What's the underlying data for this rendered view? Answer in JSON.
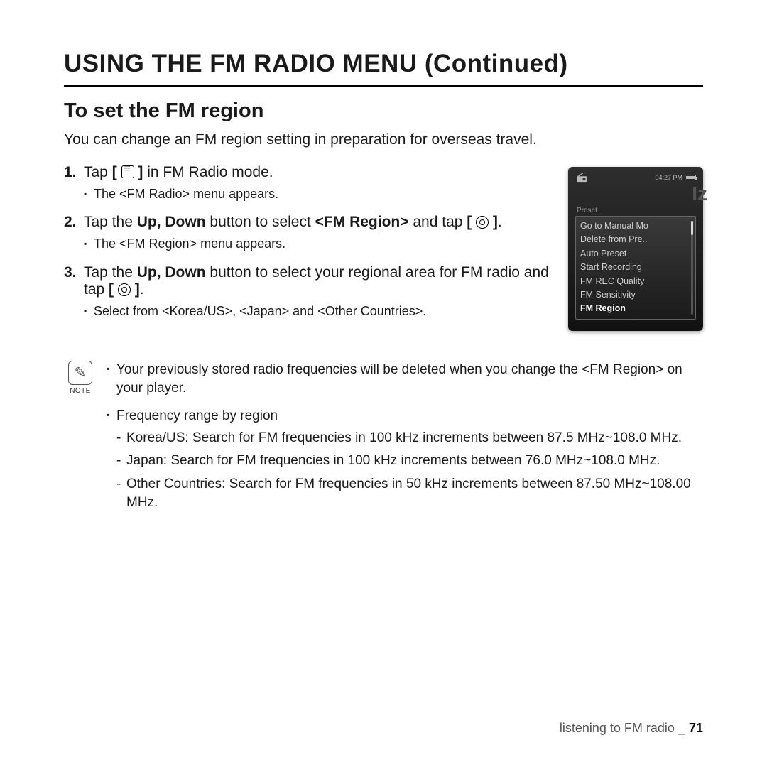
{
  "page": {
    "title": "USING THE FM RADIO MENU (Continued)",
    "section": "To set the FM region",
    "intro": "You can change an FM region setting in preparation for overseas travel."
  },
  "steps": [
    {
      "num": "1.",
      "pre": "Tap ",
      "icon": "menu-icon",
      "post": " in FM Radio mode.",
      "sub": [
        "The <FM Radio> menu appears."
      ]
    },
    {
      "num": "2.",
      "pre": "Tap the ",
      "bold1": "Up, Down",
      "mid1": " button to select ",
      "bold2": "<FM Region>",
      "mid2": " and tap ",
      "icon": "select-icon",
      "post": ".",
      "sub": [
        "The <FM Region> menu appears."
      ]
    },
    {
      "num": "3.",
      "pre": "Tap the ",
      "bold1": "Up, Down",
      "mid1": " button to select your regional area for FM radio and tap ",
      "icon": "select-icon",
      "post": ".",
      "sub": [
        "Select from <Korea/US>, <Japan> and <Other Countries>."
      ]
    }
  ],
  "device": {
    "time": "04:27 PM",
    "preset_label": "Preset",
    "hz_bg": "Iz",
    "menu": [
      {
        "label": "Go to Manual Mo",
        "sel": false
      },
      {
        "label": "Delete from Pre..",
        "sel": false
      },
      {
        "label": "Auto Preset",
        "sel": false
      },
      {
        "label": "Start Recording",
        "sel": false
      },
      {
        "label": "FM REC Quality",
        "sel": false
      },
      {
        "label": "FM Sensitivity",
        "sel": false
      },
      {
        "label": "FM Region",
        "sel": true
      }
    ]
  },
  "note": {
    "label": "NOTE",
    "items": [
      "Your previously stored radio frequencies will be deleted when you change the <FM Region> on your player.",
      "Frequency range by region"
    ],
    "ranges": [
      "Korea/US: Search for FM frequencies in 100 kHz increments between 87.5 MHz~108.0 MHz.",
      "Japan: Search for FM frequencies in 100 kHz increments between 76.0 MHz~108.0 MHz.",
      "Other Countries: Search for FM frequencies in 50 kHz increments between 87.50 MHz~108.00 MHz."
    ]
  },
  "footer": {
    "section": "listening to FM radio _",
    "page": "71"
  }
}
